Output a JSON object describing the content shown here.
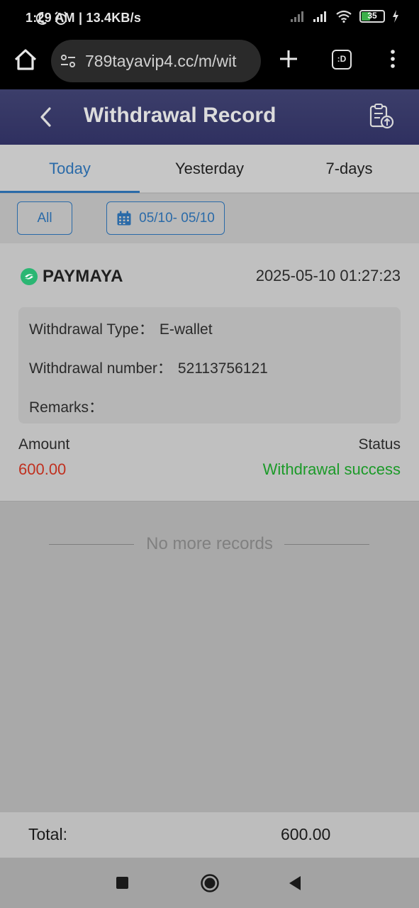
{
  "status_bar": {
    "time": "1:29 AM | 13.4KB/s",
    "battery": "35"
  },
  "browser": {
    "url": "789tayavip4.cc/m/wit",
    "tabs_icon_label": ":D"
  },
  "header": {
    "title": "Withdrawal Record"
  },
  "tabs": [
    {
      "label": "Today",
      "active": true
    },
    {
      "label": "Yesterday",
      "active": false
    },
    {
      "label": "7-days",
      "active": false
    }
  ],
  "filters": {
    "type_label": "All",
    "date_range": "05/10- 05/10"
  },
  "record": {
    "method": "PAYMAYA",
    "datetime": "2025-05-10 01:27:23",
    "type_label": "Withdrawal Type：",
    "type_value": "E-wallet",
    "number_label": "Withdrawal number：",
    "number_value": "52113756121",
    "remarks_label": "Remarks：",
    "remarks_value": "",
    "amount_label": "Amount",
    "amount_value": "600.00",
    "status_label": "Status",
    "status_value": "Withdrawal success"
  },
  "list_end_text": "No more records",
  "footer": {
    "total_label": "Total:",
    "total_value": "600.00"
  },
  "colors": {
    "accent": "#2a6aa8",
    "amount": "#c0301f",
    "success": "#1b9a28",
    "header_bg": "#34366a"
  }
}
